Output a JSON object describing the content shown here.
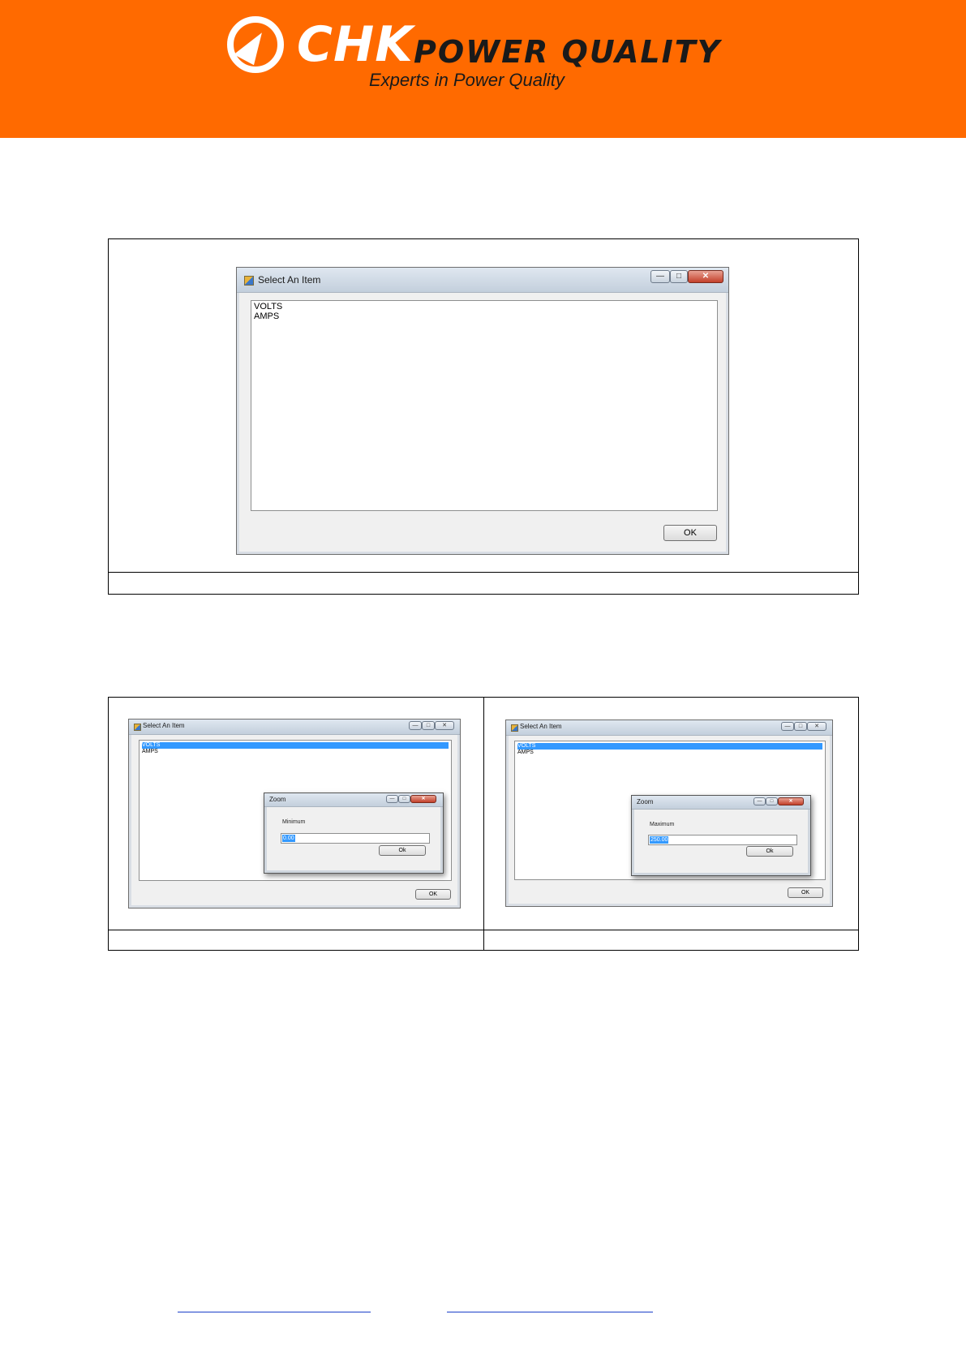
{
  "header": {
    "brand": "CHK",
    "brand_suffix": "POWER QUALITY",
    "tagline": "Experts in Power Quality",
    "colors": {
      "banner": "#ff6a00",
      "text_dark": "#1a1a1a"
    }
  },
  "figure1": {
    "dialog": {
      "title": "Select An Item",
      "items": [
        "VOLTS",
        "AMPS"
      ],
      "ok_label": "OK"
    },
    "caption": ""
  },
  "figure2": {
    "left": {
      "dialog": {
        "title": "Select An Item",
        "items": [
          "VOLTS",
          "AMPS"
        ],
        "ok_label": "OK"
      },
      "zoom": {
        "title": "Zoom",
        "label": "Minimum",
        "value": "0.00",
        "ok_label": "Ok"
      },
      "caption": ""
    },
    "right": {
      "dialog": {
        "title": "Select An Item",
        "items": [
          "VOLTS",
          "AMPS"
        ],
        "ok_label": "OK"
      },
      "zoom": {
        "title": "Zoom",
        "label": "Maximum",
        "value": "250.00",
        "ok_label": "Ok"
      },
      "caption": ""
    }
  },
  "footer": {
    "links": [
      "",
      ""
    ],
    "colors": {
      "link": "#1a3fc9"
    }
  }
}
